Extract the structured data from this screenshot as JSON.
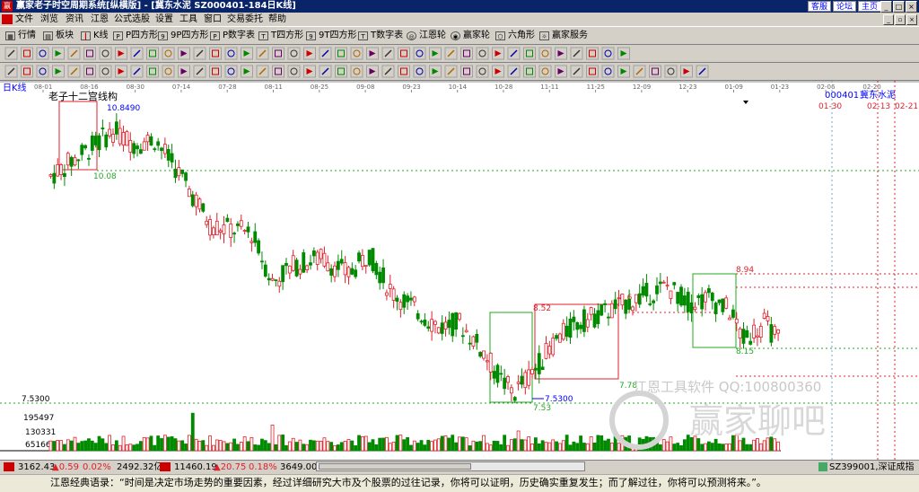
{
  "window": {
    "title": "赢家老子时空周期系统[纵横版] - [冀东水泥  SZ000401-184日K线]",
    "links": [
      "客服",
      "论坛",
      "主页"
    ]
  },
  "menu": [
    "文件",
    "浏览",
    "资讯",
    "江恩",
    "公式选股",
    "设置",
    "工具",
    "窗口",
    "交易委托",
    "帮助"
  ],
  "toolbar1": [
    {
      "label": "行情",
      "icon": "grid-icon"
    },
    {
      "label": "板块",
      "icon": "blocks-icon"
    },
    {
      "label": "K线",
      "icon": "candle-icon"
    },
    {
      "label": "P四方形",
      "icon": "square-p-icon"
    },
    {
      "label": "9P四方形",
      "icon": "square-9p-icon"
    },
    {
      "label": "P数字表",
      "icon": "table-p-icon"
    },
    {
      "label": "T四方形",
      "icon": "square-t-icon"
    },
    {
      "label": "9T四方形",
      "icon": "square-9t-icon"
    },
    {
      "label": "T数字表",
      "icon": "table-t-icon"
    },
    {
      "label": "江恩轮",
      "icon": "wheel-icon"
    },
    {
      "label": "赢家轮",
      "icon": "wheel2-icon"
    },
    {
      "label": "六角形",
      "icon": "hexagon-icon"
    },
    {
      "label": "赢家服务",
      "icon": "service-icon"
    }
  ],
  "chart_header": {
    "period_label": "日K线",
    "indicator_label": "老子十二宫线构",
    "stock_code": "000401",
    "stock_name": "冀东水泥"
  },
  "date_axis": [
    "08-01",
    "08-16",
    "08-30",
    "07-14",
    "07-28",
    "08-11",
    "08-25",
    "09-08",
    "09-23",
    "10-14",
    "10-28",
    "11-11",
    "11-25",
    "12-09",
    "12-23",
    "01-09",
    "01-23",
    "02-06",
    "02-20"
  ],
  "future_dates": [
    "01-30",
    "02-13",
    "02-21"
  ],
  "volume_axis": [
    "195497",
    "130331",
    "65166"
  ],
  "chart_data": {
    "type": "candlestick",
    "price_range": [
      7.3,
      11.2
    ],
    "annotations": {
      "high_label": "10.8490",
      "low_label": "7.5300",
      "left_axis_low": "7.5300",
      "levels": [
        {
          "label": "10.08",
          "value": 10.08
        },
        {
          "label": "8.94",
          "value": 8.94
        },
        {
          "label": "8.52",
          "value": 8.52
        },
        {
          "label": "8.6",
          "value": 8.6
        },
        {
          "label": "8.15",
          "value": 8.15
        },
        {
          "label": "7.78",
          "value": 7.78
        },
        {
          "label": "7.53",
          "value": 7.53
        }
      ]
    }
  },
  "watermark": {
    "line1": "江恩工具软件  QQ:100800360",
    "line2": "赢家聊吧"
  },
  "status": {
    "sh_index": "3162.43",
    "sh_change": "▲0.59",
    "sh_pct": "0.02%",
    "sh_amount": "2492.32亿",
    "sz_index": "11460.19",
    "sz_change": "▲20.75",
    "sz_pct": "0.18%",
    "sz_amount": "3649.00",
    "sz_code": "SZ399001,深证成指"
  },
  "quote": "江恩经典语录：“时间是决定市场走势的重要因素，经过详细研究大市及个股票的过往记录，你将可以证明，历史确实重复发生；而了解过往，你将可以预测将来。”。",
  "colors": {
    "up": "#e0202a",
    "down": "#008a00",
    "title_bg": "#0a246a",
    "toolbar_bg": "#d4d0c8"
  }
}
